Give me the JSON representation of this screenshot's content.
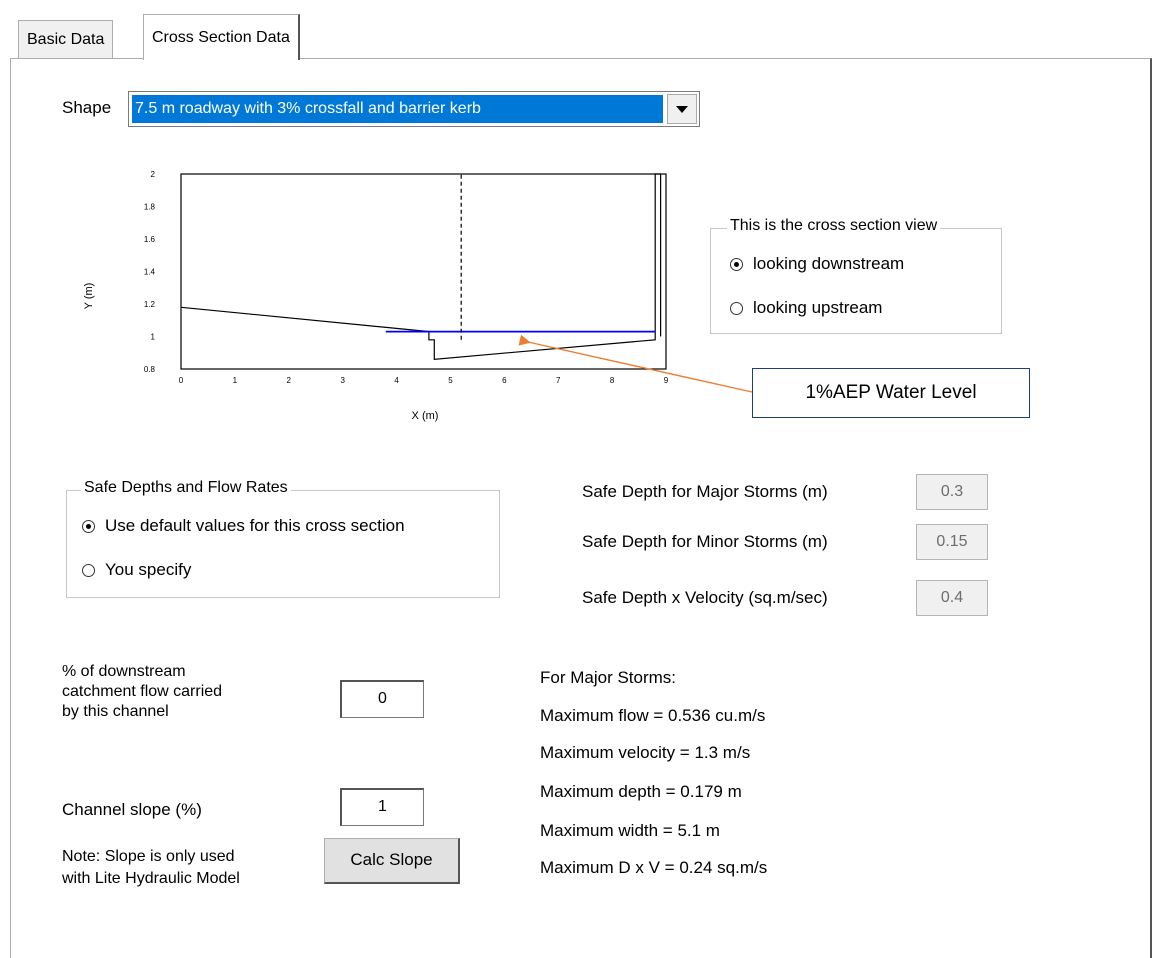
{
  "tabs": [
    {
      "label": "Basic Data",
      "active": false
    },
    {
      "label": "Cross Section Data",
      "active": true
    }
  ],
  "shape": {
    "label": "Shape",
    "selected": "7.5 m roadway with 3% crossfall and barrier kerb"
  },
  "chart_data": {
    "type": "line",
    "xlabel": "X (m)",
    "ylabel": "Y (m)",
    "xlim": [
      0,
      9
    ],
    "ylim": [
      0.8,
      2
    ],
    "xticks": [
      "0",
      "1",
      "2",
      "3",
      "4",
      "5",
      "6",
      "7",
      "8",
      "9"
    ],
    "yticks": [
      "0.8",
      "1",
      "1.2",
      "1.4",
      "1.6",
      "1.8",
      "2"
    ],
    "series": [
      {
        "role": "cross-section",
        "x": [
          0,
          4.6,
          4.6,
          4.7,
          4.7,
          8.8,
          8.8,
          8.9,
          8.9
        ],
        "y": [
          1.18,
          1.03,
          0.98,
          0.98,
          0.86,
          0.98,
          2.0,
          2.0,
          1.0
        ]
      },
      {
        "role": "water-level",
        "x": [
          3.8,
          8.8
        ],
        "y": [
          1.03,
          1.03
        ]
      },
      {
        "role": "centre-line",
        "x": [
          5.2,
          5.2
        ],
        "y": [
          0.98,
          2.0
        ]
      }
    ],
    "colors": {
      "cross_section": "#000000",
      "water": "#0000ff",
      "centre": "#000000",
      "callout_arrow": "#ed7d31"
    }
  },
  "view_group": {
    "title": "This is the cross section view",
    "options": [
      {
        "label": "looking downstream",
        "checked": true
      },
      {
        "label": "looking upstream",
        "checked": false
      }
    ]
  },
  "callout": {
    "text": "1%AEP Water Level"
  },
  "safe_group": {
    "title": "Safe Depths and Flow Rates",
    "options": [
      {
        "label": "Use default values for this cross section",
        "checked": true
      },
      {
        "label": "You specify",
        "checked": false
      }
    ]
  },
  "safe_values": [
    {
      "label": "Safe Depth for Major Storms (m)",
      "value": "0.3"
    },
    {
      "label": "Safe Depth for Minor Storms (m)",
      "value": "0.15"
    },
    {
      "label": "Safe Depth x Velocity (sq.m/sec)",
      "value": "0.4"
    }
  ],
  "flow_percent": {
    "label_lines": [
      "% of downstream",
      "catchment flow carried",
      "by this channel"
    ],
    "value": "0"
  },
  "slope": {
    "label": "Channel slope (%)",
    "value": "1",
    "note_lines": [
      "Note:  Slope is only used",
      "with Lite Hydraulic Model"
    ],
    "button": "Calc Slope"
  },
  "results": {
    "heading": "For Major Storms:",
    "lines": [
      "Maximum flow = 0.536 cu.m/s",
      "Maximum velocity = 1.3 m/s",
      "Maximum depth = 0.179 m",
      "Maximum width = 5.1 m",
      "Maximum D x V = 0.24 sq.m/s"
    ]
  }
}
